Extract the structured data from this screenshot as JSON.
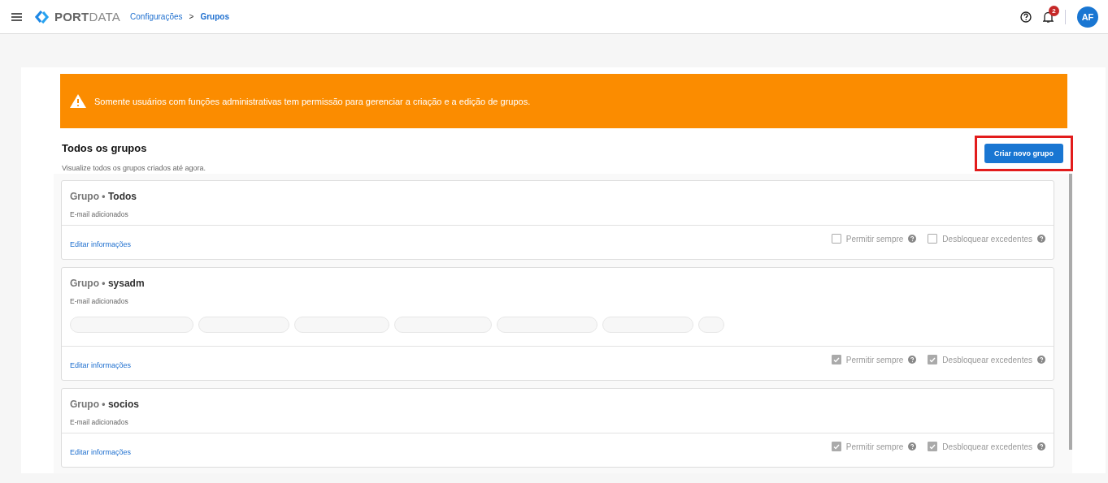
{
  "header": {
    "brand": {
      "strong": "PORT",
      "light": "DATA"
    },
    "breadcrumb": [
      {
        "label": "Configurações",
        "current": false
      },
      {
        "label": "Grupos",
        "current": true
      }
    ],
    "breadcrumb_separator": ">",
    "notifications": "2",
    "avatar": "AF"
  },
  "alert": {
    "text": "Somente usuários com funções administrativas tem permissão para gerenciar a criação e a edição de grupos."
  },
  "section": {
    "title": "Todos os grupos",
    "subtitle": "Visualize todos os grupos criados até agora.",
    "create_button": {
      "label": "Criar novo grupo",
      "highlighted": true
    }
  },
  "groups": [
    {
      "prefix": "Grupo",
      "separator": "•",
      "name": "Todos",
      "emails_label": "E-mail adicionados",
      "blurred_emails": false,
      "edit": "Editar informações",
      "options": [
        {
          "label": "Permitir sempre",
          "checked": false
        },
        {
          "label": "Desbloquear excedentes",
          "checked": false
        }
      ]
    },
    {
      "prefix": "Grupo",
      "separator": "•",
      "name": "sysadm",
      "emails_label": "E-mail adicionados",
      "blurred_emails": true,
      "edit": "Editar informações",
      "options": [
        {
          "label": "Permitir sempre",
          "checked": true
        },
        {
          "label": "Desbloquear excedentes",
          "checked": true
        }
      ]
    },
    {
      "prefix": "Grupo",
      "separator": "•",
      "name": "socios",
      "emails_label": "E-mail adicionados",
      "blurred_emails": false,
      "edit": "Editar informações",
      "options": [
        {
          "label": "Permitir sempre",
          "checked": true
        },
        {
          "label": "Desbloquear excedentes",
          "checked": true
        }
      ]
    }
  ]
}
